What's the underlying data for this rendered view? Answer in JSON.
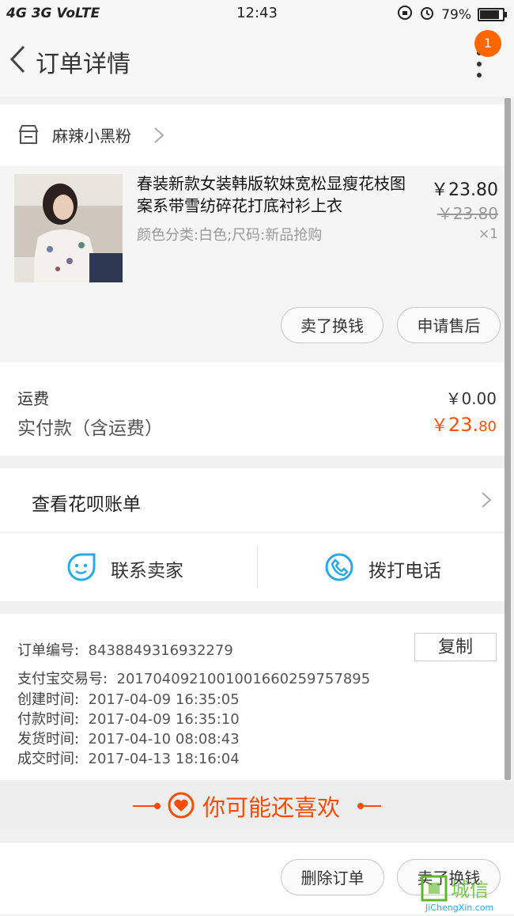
{
  "status_bar": {
    "left": "4G 3G VoLTE",
    "time": "12:43",
    "battery": "79%",
    "battery_level": 0.79
  },
  "header": {
    "title": "订单详情",
    "badge_count": "1"
  },
  "shop": {
    "name": "麻辣小黑粉"
  },
  "product": {
    "title": "春装新款女装韩版软妹宽松显瘦花枝图案系带雪纺碎花打底衬衫上衣",
    "spec": "颜色分类:白色;尺码:新品抢购",
    "price": "￥23.80",
    "original_price": "￥23.80",
    "quantity": "×1",
    "buttons": {
      "sell": "卖了换钱",
      "after_sale": "申请售后"
    }
  },
  "totals": {
    "shipping_label": "运费",
    "shipping_value": "￥0.00",
    "paid_label": "实付款（含运费）",
    "paid_currency": "￥",
    "paid_int": "23.",
    "paid_dec": "80"
  },
  "huabei": {
    "label": "查看花呗账单"
  },
  "contact": {
    "seller_label": "联系卖家",
    "phone_label": "拨打电话"
  },
  "order_info": {
    "copy_label": "复制",
    "rows": [
      {
        "label": "订单编号:",
        "value": "8438849316932279"
      },
      {
        "label": "支付宝交易号:",
        "value": "2017040921001001660259757895"
      },
      {
        "label": "创建时间:",
        "value": "2017-04-09 16:35:05"
      },
      {
        "label": "付款时间:",
        "value": "2017-04-09 16:35:10"
      },
      {
        "label": "发货时间:",
        "value": "2017-04-10 08:08:43"
      },
      {
        "label": "成交时间:",
        "value": "2017-04-13 18:16:04"
      }
    ]
  },
  "recommend": {
    "label": "你可能还喜欢"
  },
  "bottom_bar": {
    "delete_label": "删除订单",
    "sell_label": "卖了换钱"
  },
  "watermark": {
    "text": "JiChengXin.com"
  },
  "colors": {
    "accent": "#ff5000",
    "badge": "#ff6600",
    "icon_blue": "#2aa8e8",
    "recommend": "#ff4c00"
  }
}
